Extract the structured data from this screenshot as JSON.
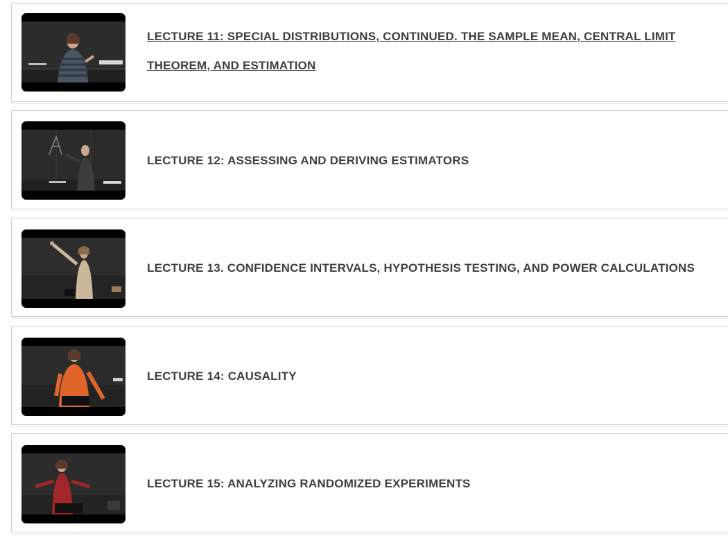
{
  "lectures": [
    {
      "title": "LECTURE 11: SPECIAL DISTRIBUTIONS, CONTINUED. THE SAMPLE MEAN, CENTRAL LIMIT THEOREM, AND ESTIMATION",
      "linked": true,
      "speaker_top": "striped sweater"
    },
    {
      "title": "LECTURE 12: ASSESSING AND DERIVING ESTIMATORS",
      "linked": false,
      "speaker_top": "dark jacket"
    },
    {
      "title": "LECTURE 13. CONFIDENCE INTERVALS, HYPOTHESIS TESTING, AND POWER CALCULATIONS",
      "linked": false,
      "speaker_top": "beige blazer"
    },
    {
      "title": "LECTURE 14: CAUSALITY",
      "linked": false,
      "speaker_top": "orange top"
    },
    {
      "title": "LECTURE 15: ANALYZING RANDOMIZED EXPERIMENTS",
      "linked": false,
      "speaker_top": "red top"
    }
  ],
  "colors": {
    "text": "#3f3f3f",
    "border": "#cfcfcf",
    "thumb_bg": "#000000",
    "board": "#2e2f2e"
  }
}
